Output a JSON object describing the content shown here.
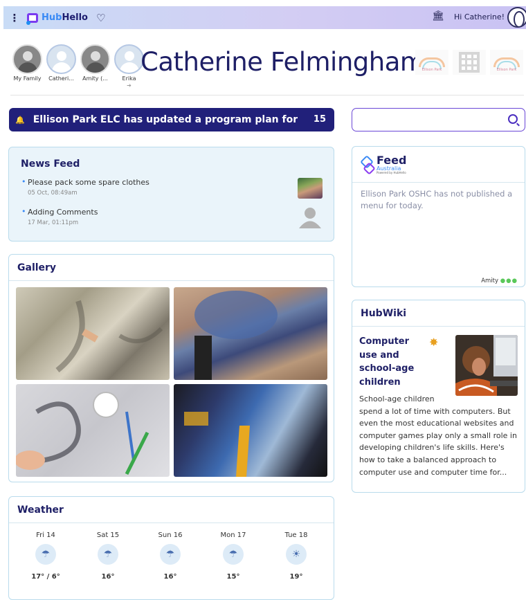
{
  "topbar": {
    "brand_hub": "Hub",
    "brand_hello": "Hello",
    "greeting": "Hi Catherine!"
  },
  "profiles": [
    {
      "label": "My Family",
      "selected": true
    },
    {
      "label": "Catheri...",
      "selected": false
    },
    {
      "label": "Amity (...",
      "selected": false
    },
    {
      "label": "Erika",
      "selected": false
    }
  ],
  "header": {
    "name": "Catherine Felmingham",
    "centre_logo_caption": "Ellison Park"
  },
  "banner": {
    "text": "Ellison Park ELC has updated a program plan for An",
    "count": "15"
  },
  "news_feed": {
    "title": "News Feed",
    "items": [
      {
        "title": "Please pack some spare clothes",
        "date": "05 Oct, 08:49am"
      },
      {
        "title": "Adding Comments",
        "date": "17 Mar, 01:11pm"
      }
    ]
  },
  "gallery": {
    "title": "Gallery"
  },
  "weather": {
    "title": "Weather",
    "days": [
      {
        "day": "Fri 14",
        "temp": "17° / 6°",
        "icon": "rain-cloud-icon"
      },
      {
        "day": "Sat 15",
        "temp": "16°",
        "icon": "rain-cloud-icon"
      },
      {
        "day": "Sun 16",
        "temp": "16°",
        "icon": "rain-cloud-icon"
      },
      {
        "day": "Mon 17",
        "temp": "15°",
        "icon": "rain-cloud-icon"
      },
      {
        "day": "Tue 18",
        "temp": "19°",
        "icon": "partly-sunny-icon"
      }
    ]
  },
  "feed": {
    "brand": "Feed",
    "brand_sub": "Australia",
    "brand_powered": "Powered by HubHello",
    "message": "Ellison Park OSHC has not published a menu for today.",
    "footer": "Amity"
  },
  "hubwiki": {
    "title": "HubWiki",
    "article_title": "Computer use and school-age children",
    "article_first_line": "School-age children",
    "article_rest": "spend a lot of time with computers. But even the most educational websites and computer games play only a small role in developing children's life skills. Here's how to take a balanced approach to computer use and computer time for..."
  },
  "colors": {
    "brand_navy": "#21207a",
    "accent_purple": "#6a46d6",
    "card_border": "#b9dbec"
  }
}
